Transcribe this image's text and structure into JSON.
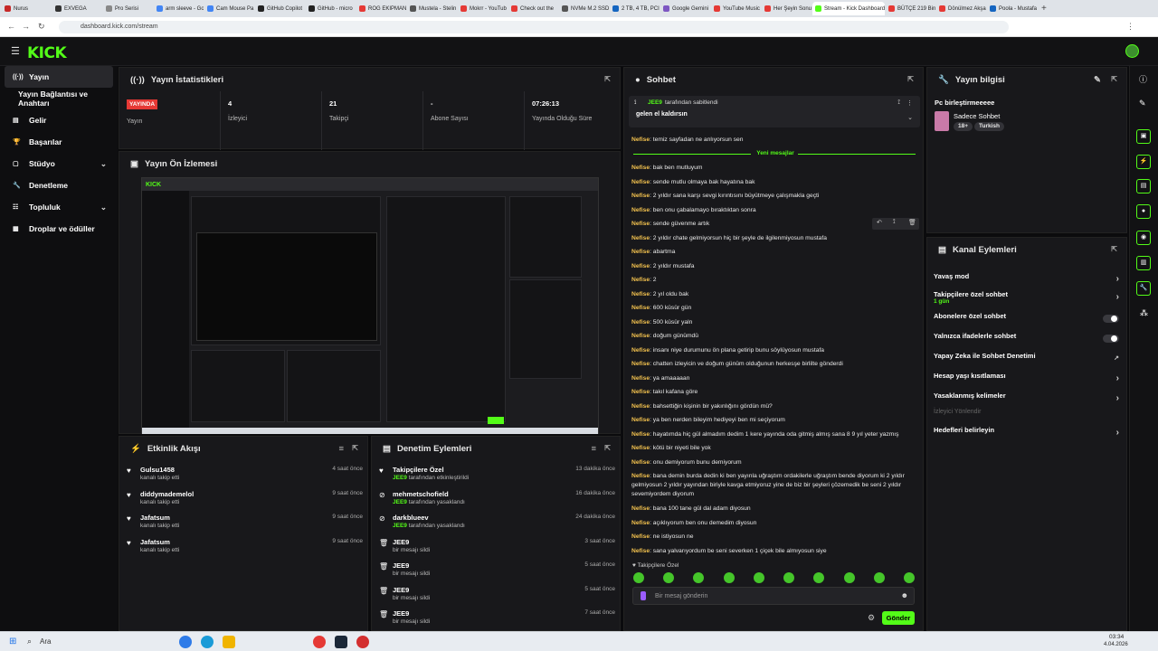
{
  "browser": {
    "tabs": [
      {
        "label": "Nurus",
        "color": "#c62828",
        "active": false
      },
      {
        "label": "EXVEGA",
        "color": "#333333",
        "active": false
      },
      {
        "label": "Pro Serisi",
        "color": "#888888",
        "active": false
      },
      {
        "label": "arm sleeve - Go",
        "color": "#4285f4",
        "active": false
      },
      {
        "label": "Cam Mouse Pa",
        "color": "#4285f4",
        "active": false
      },
      {
        "label": "GitHub Copilot",
        "color": "#222222",
        "active": false
      },
      {
        "label": "GitHub - micro",
        "color": "#222222",
        "active": false
      },
      {
        "label": "ROG EKIPMAN",
        "color": "#e53935",
        "active": false
      },
      {
        "label": "Mustela - Stelin",
        "color": "#555555",
        "active": false
      },
      {
        "label": "Mokrr - YouTub",
        "color": "#e53935",
        "active": false
      },
      {
        "label": "Check out the",
        "color": "#e53935",
        "active": false
      },
      {
        "label": "NVMe M.2 SSD",
        "color": "#555555",
        "active": false
      },
      {
        "label": "2 TB, 4 TB, PCI",
        "color": "#1565c0",
        "active": false
      },
      {
        "label": "Google Gemini",
        "color": "#7e57c2",
        "active": false
      },
      {
        "label": "YouTube Music",
        "color": "#e53935",
        "active": false
      },
      {
        "label": "Her Şeyin Sonu",
        "color": "#e53935",
        "active": false
      },
      {
        "label": "Stream - Kick Dashboard",
        "color": "#53fc18",
        "active": true
      },
      {
        "label": "BÜTÇE 219 Bin",
        "color": "#e53935",
        "active": false
      },
      {
        "label": "Dönülmez Akşa",
        "color": "#e53935",
        "active": false
      },
      {
        "label": "Poola - Mustafa",
        "color": "#1565c0",
        "active": false
      }
    ],
    "url": "dashboard.kick.com/stream"
  },
  "sidebar": {
    "items": [
      {
        "label": "Yayın",
        "icon": "broadcast-icon",
        "active": true
      },
      {
        "label": "Yayın Bağlantısı ve Anahtarı",
        "icon": "",
        "active": false
      },
      {
        "label": "Gelir",
        "icon": "wallet-icon",
        "active": false
      },
      {
        "label": "Başarılar",
        "icon": "trophy-icon",
        "active": false
      },
      {
        "label": "Stüdyo",
        "icon": "studio-icon",
        "active": false,
        "expand": true
      },
      {
        "label": "Denetleme",
        "icon": "wrench-icon",
        "active": false
      },
      {
        "label": "Topluluk",
        "icon": "community-icon",
        "active": false,
        "expand": true
      },
      {
        "label": "Droplar ve ödüller",
        "icon": "gift-icon",
        "active": false
      }
    ]
  },
  "stats": {
    "title": "Yayın İstatistikleri",
    "live_badge": "YAYINDA",
    "live_label": "Yayın",
    "cells": [
      {
        "value": "4",
        "label": "İzleyici"
      },
      {
        "value": "21",
        "label": "Takipçi"
      },
      {
        "value": "-",
        "label": "Abone Sayısı"
      },
      {
        "value": "07:26:13",
        "label": "Yayında Olduğu Süre"
      }
    ]
  },
  "preview": {
    "title": "Yayın Ön İzlemesi"
  },
  "activity": {
    "title": "Etkinlik Akışı",
    "items": [
      {
        "name": "Gulsu1458",
        "sub": "kanalı takip etti",
        "time": "4 saat önce"
      },
      {
        "name": "diddymademelol",
        "sub": "kanalı takip etti",
        "time": "9 saat önce"
      },
      {
        "name": "Jafatsum",
        "sub": "kanalı takip etti",
        "time": "9 saat önce"
      },
      {
        "name": "Jafatsum",
        "sub": "kanalı takip etti",
        "time": "9 saat önce"
      }
    ]
  },
  "modactions": {
    "title": "Denetim Eylemleri",
    "items": [
      {
        "name": "Takipçilere Özel",
        "who": "JEE9",
        "sub": " tarafından etkinleştirildi",
        "time": "13 dakika önce",
        "icon": "heart-icon"
      },
      {
        "name": "mehmetschofield",
        "who": "JEE9",
        "sub": " tarafından yasaklandı",
        "time": "16 dakika önce",
        "icon": "ban-icon"
      },
      {
        "name": "darkblueev",
        "who": "JEE9",
        "sub": " tarafından yasaklandı",
        "time": "24 dakika önce",
        "icon": "ban-icon"
      },
      {
        "name": "JEE9",
        "who": "",
        "sub": "bir mesajı sildi",
        "time": "3 saat önce",
        "icon": "trash-icon"
      },
      {
        "name": "JEE9",
        "who": "",
        "sub": "bir mesajı sildi",
        "time": "5 saat önce",
        "icon": "trash-icon"
      },
      {
        "name": "JEE9",
        "who": "",
        "sub": "bir mesajı sildi",
        "time": "5 saat önce",
        "icon": "trash-icon"
      },
      {
        "name": "JEE9",
        "who": "",
        "sub": "bir mesajı sildi",
        "time": "7 saat önce",
        "icon": "trash-icon"
      }
    ]
  },
  "chat": {
    "title": "Sohbet",
    "pinned_by_user": "JEE9",
    "pinned_by_text": "tarafından sabitlendi",
    "pinned_message": "gelen el kaldırsın",
    "divider": "Yeni mesajlar",
    "messages": [
      {
        "user": "Nefise",
        "text": "temiz sayfadan ne anlıyorsun sen"
      },
      {
        "user": "Nefise",
        "text": "bak ben mutluyum"
      },
      {
        "user": "Nefise",
        "text": "sende mutlu olmaya bak hayatına bak"
      },
      {
        "user": "Nefise",
        "text": "2 yıldır sana karşı sevgi kırıntısını büyütmeye çalışmakla geçti"
      },
      {
        "user": "Nefise",
        "text": "ben onu çabalamayo bıraktıktan sonra"
      },
      {
        "user": "Nefise",
        "text": "sende güvenme artık"
      },
      {
        "user": "Nefise",
        "text": "2 yıldır chate gelmiyorsun hiç bir şeyle de ilgilenmiyosun mustafa"
      },
      {
        "user": "Nefise",
        "text": "abartma"
      },
      {
        "user": "Nefise",
        "text": "2 yıldır mustafa"
      },
      {
        "user": "Nefise",
        "text": "2"
      },
      {
        "user": "Nefise",
        "text": "2 yıl oldu bak"
      },
      {
        "user": "Nefise",
        "text": "600 küsür gün"
      },
      {
        "user": "Nefise",
        "text": "500 küsür yaln"
      },
      {
        "user": "Nefise",
        "text": "doğum günümdü"
      },
      {
        "user": "Nefise",
        "text": "insanı niye durumunu ön plana getirip bunu söylüyosun mustafa"
      },
      {
        "user": "Nefise",
        "text": "chatten izleyicin ve doğum günüm olduğunun herkesşe birlilte gönderdi"
      },
      {
        "user": "Nefise",
        "text": "ya amaaaaan"
      },
      {
        "user": "Nefise",
        "text": "takıl kafana göre"
      },
      {
        "user": "Nefise",
        "text": "bahsettiğin kişinin bir yakınlığını gördün mü?"
      },
      {
        "user": "Nefise",
        "text": "ya ben nerden bileyim hediyeyi ben mi seçiyorum"
      },
      {
        "user": "Nefise",
        "text": "hayatımda hiç gül almadım dedim 1 kere yayında oda gitmiş almış sana 8 9 yıl yeter yazmış"
      },
      {
        "user": "Nefise",
        "text": "kötü bir niyeti bile yok"
      },
      {
        "user": "Nefise",
        "text": "onu demiyorum bunu demiyorum"
      },
      {
        "user": "Nefise",
        "text": "bana demin burda dedin ki ben yayınla uğraştım ordakilerle uğraştım bende diyorum ki 2 yıldır gelmiyosun 2 yıldır yayından biriyle kavga etmiyoruz yine de biz bir şeyleri çözemedik be seni 2 yıldır sevemiyordem diyorum"
      },
      {
        "user": "Nefise",
        "text": "bana 100 tane gül dal adam diyosun"
      },
      {
        "user": "Nefise",
        "text": "açıklıyorum ben onu demedim diyosun"
      },
      {
        "user": "Nefise",
        "text": "ne istiyosun ne"
      },
      {
        "user": "Nefise",
        "text": "sana yalvarıyordum be seni severken 1 çiçek bile almıyosun siye"
      }
    ],
    "mode_label": "Takipçilere Özel",
    "input_placeholder": "Bir mesaj gönderin",
    "send_label": "Gönder"
  },
  "streaminfo": {
    "title": "Yayın bilgisi",
    "stream_title": "Pc birleştirmeeeee",
    "category": "Sadece Sohbet",
    "tags": [
      "18+",
      "Turkish"
    ]
  },
  "channel": {
    "title": "Kanal Eylemleri",
    "actions": [
      {
        "label": "Yavaş mod",
        "sub": "",
        "control": "arrow"
      },
      {
        "label": "Takipçilere özel sohbet",
        "sub": "1 gün",
        "control": "arrow"
      },
      {
        "label": "Abonelere özel sohbet",
        "sub": "",
        "control": "toggle"
      },
      {
        "label": "Yalnızca ifadelerle sohbet",
        "sub": "",
        "control": "toggle"
      },
      {
        "label": "Yapay Zeka ile Sohbet Denetimi",
        "sub": "",
        "control": "external"
      },
      {
        "label": "Hesap yaşı kısıtlaması",
        "sub": "",
        "control": "arrow"
      },
      {
        "label": "Yasaklanmış kelimeler",
        "sub": "",
        "control": "arrow"
      },
      {
        "label": "İzleyici Yönlendir",
        "sub": "",
        "control": "none",
        "disabled": true
      },
      {
        "label": "Hedefleri belirleyin",
        "sub": "",
        "control": "arrow"
      }
    ]
  },
  "taskbar": {
    "search": "Ara",
    "time": "03:34",
    "date": "4.04.2026"
  },
  "colors": {
    "accent": "#53fc18",
    "live": "#e53935",
    "username": "#f2c14e"
  }
}
